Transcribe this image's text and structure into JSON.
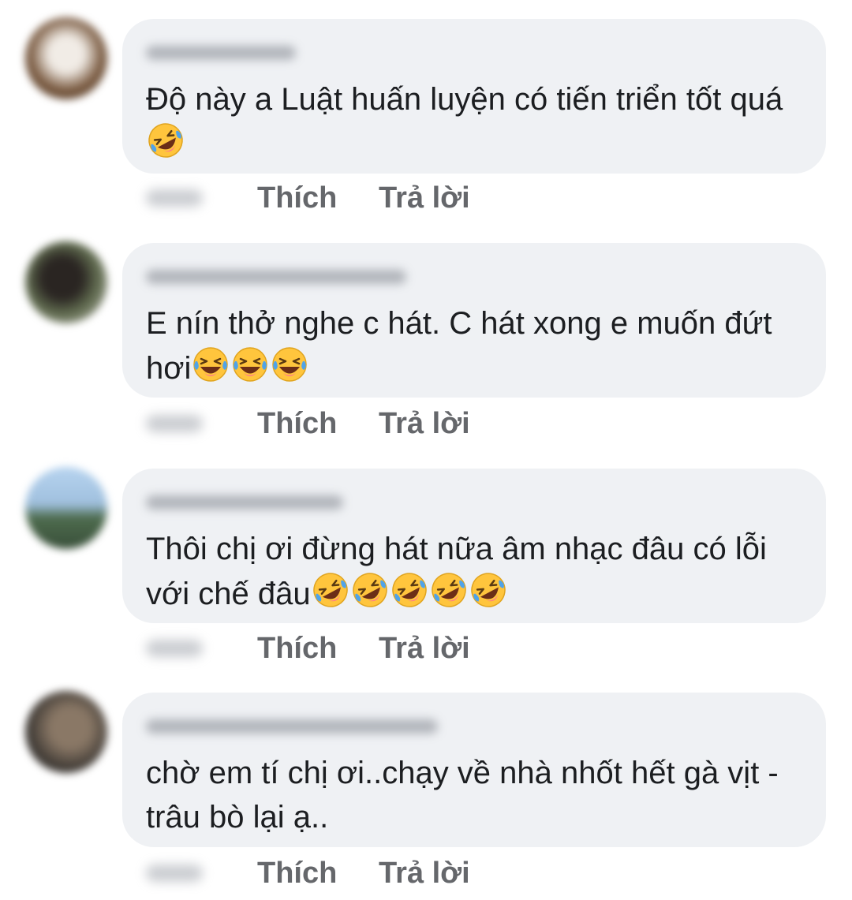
{
  "comments": [
    {
      "text": "Độ này a Luật huấn luyện có tiến triển tốt quá",
      "emojis": [
        "rolling-on-floor-laughing"
      ],
      "actions": {
        "like": "Thích",
        "reply": "Trả lời"
      }
    },
    {
      "text": "E nín thở nghe c hát. C hát xong e muốn đứt hơi",
      "emojis": [
        "face-with-tears-of-joy",
        "face-with-tears-of-joy",
        "face-with-tears-of-joy"
      ],
      "actions": {
        "like": "Thích",
        "reply": "Trả lời"
      }
    },
    {
      "text": "Thôi chị ơi đừng hát nữa âm nhạc đâu có lỗi với chế đâu",
      "emojis": [
        "rolling-on-floor-laughing",
        "rolling-on-floor-laughing",
        "rolling-on-floor-laughing",
        "rolling-on-floor-laughing",
        "rolling-on-floor-laughing"
      ],
      "actions": {
        "like": "Thích",
        "reply": "Trả lời"
      }
    },
    {
      "text": "chờ em tí chị ơi..chạy về nhà nhốt hết gà vịt - trâu bò lại ạ..",
      "emojis": [],
      "actions": {
        "like": "Thích",
        "reply": "Trả lời"
      }
    }
  ],
  "colors": {
    "bubble": "#eff1f4",
    "text": "#1c1e21",
    "action": "#65676b",
    "emoji_face": "#ffc53d",
    "emoji_tear": "#4fa3ea"
  }
}
